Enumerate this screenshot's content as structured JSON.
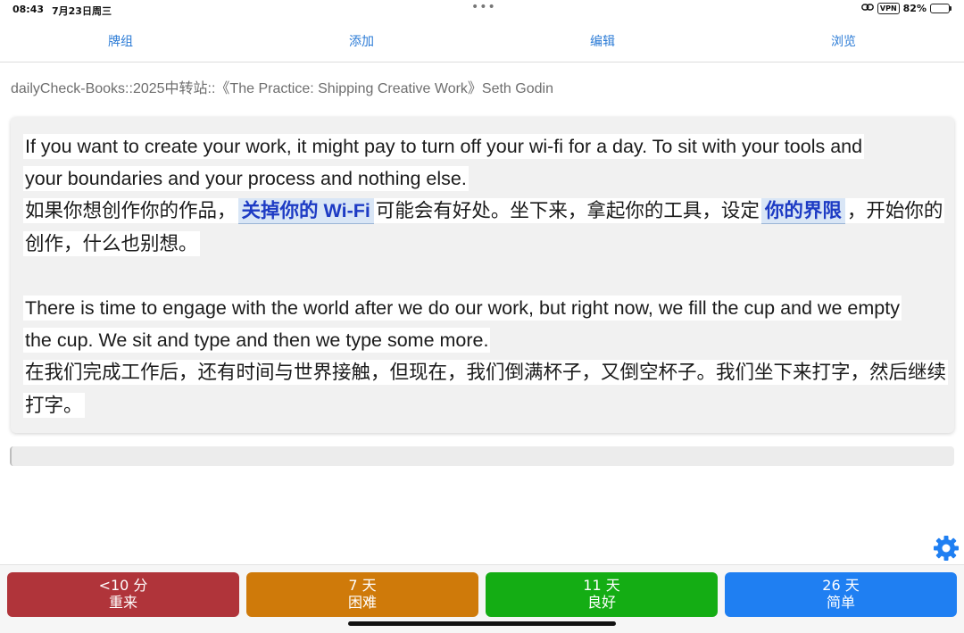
{
  "status_bar": {
    "time": "08:43",
    "date": "7月23日周三",
    "dots": "•••",
    "vpn": "VPN",
    "battery": "82%",
    "battery_level": 0.82
  },
  "toolbar": {
    "items": [
      {
        "label": "牌组",
        "icon": "none"
      },
      {
        "label": "添加",
        "icon": "none"
      },
      {
        "label": "编辑",
        "icon": "none"
      },
      {
        "label": "浏览",
        "icon": "none"
      }
    ]
  },
  "deck_path": "dailyCheck-Books::2025中转站::《The Practice: Shipping Creative Work》Seth Godin",
  "card": {
    "p1_en_line1": "If you want to create your work, it might pay to turn off your wi-fi for a day. To sit with your tools and",
    "p1_en_line2": "your boundaries and your process and nothing else.",
    "p1_zh_pre": "如果你想创作你的作品，",
    "p1_zh_mark1": "关掉你的 Wi-Fi",
    "p1_zh_mid": "可能会有好处。坐下来，拿起你的工具，设定",
    "p1_zh_mark2": "你的界限",
    "p1_zh_post": "，开始你的",
    "p1_zh_line2": "创作，什么也别想。",
    "p2_en_line1": "There is time to engage with the world after we do our work, but right now, we fill the cup and we empty",
    "p2_en_line2": "the cup. We sit and type and then we type some more.",
    "p2_zh_line1": "在我们完成工作后，还有时间与世界接触，但现在，我们倒满杯子，又倒空杯子。我们坐下来打字，然后继续",
    "p2_zh_line2": "打字。"
  },
  "settings_icon": "gear-icon",
  "answer_buttons": [
    {
      "interval": "<10 分",
      "label": "重来",
      "color": "#b0343a"
    },
    {
      "interval": "7 天",
      "label": "困难",
      "color": "#cf7a0a"
    },
    {
      "interval": "11 天",
      "label": "良好",
      "color": "#14ad14"
    },
    {
      "interval": "26 天",
      "label": "简单",
      "color": "#1f7ff2"
    }
  ],
  "colors": {
    "toolbar_text": "#2b7bd6",
    "highlight_text": "#1d3bc4",
    "gear": "#1f7ff2"
  }
}
